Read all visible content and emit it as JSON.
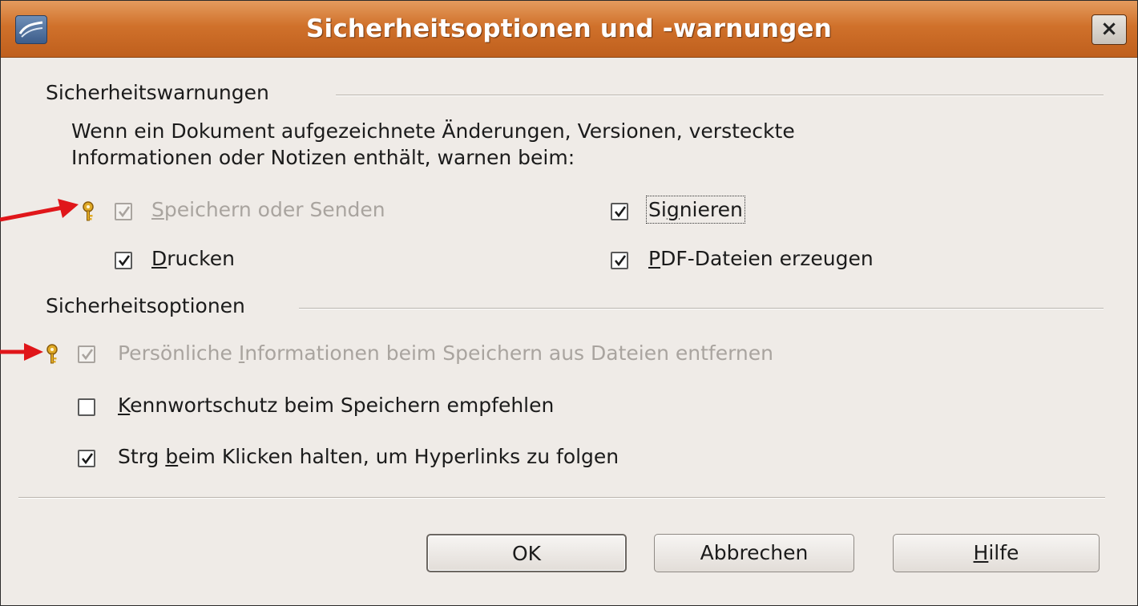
{
  "window": {
    "title": "Sicherheitsoptionen und -warnungen",
    "close_symbol": "×"
  },
  "warnings": {
    "header": "Sicherheitswarnungen",
    "description_line1": "Wenn ein Dokument aufgezeichnete Änderungen, Versionen, versteckte",
    "description_line2": "Informationen oder Notizen enthält, warnen beim:",
    "options": [
      {
        "pre": "",
        "mnemonic": "S",
        "post": "peichern oder Senden",
        "checked": true,
        "disabled": true,
        "locked": true
      },
      {
        "pre": "Si",
        "mnemonic": "g",
        "post": "nieren",
        "checked": true,
        "disabled": false,
        "locked": false,
        "focused": true
      },
      {
        "pre": "",
        "mnemonic": "D",
        "post": "rucken",
        "checked": true,
        "disabled": false,
        "locked": false
      },
      {
        "pre": "",
        "mnemonic": "P",
        "post": "DF-Dateien erzeugen",
        "checked": true,
        "disabled": false,
        "locked": false
      }
    ]
  },
  "security": {
    "header": "Sicherheitsoptionen",
    "options": [
      {
        "pre": "Persönliche ",
        "mnemonic": "I",
        "post": "nformationen beim Speichern aus Dateien entfernen",
        "checked": true,
        "disabled": true,
        "locked": true
      },
      {
        "pre": "",
        "mnemonic": "K",
        "post": "ennwortschutz beim Speichern empfehlen",
        "checked": false,
        "disabled": false,
        "locked": false
      },
      {
        "pre": "Strg ",
        "mnemonic": "b",
        "post": "eim Klicken halten, um Hyperlinks zu folgen",
        "checked": true,
        "disabled": false,
        "locked": false
      }
    ]
  },
  "buttons": {
    "ok": "OK",
    "cancel": "Abbrechen",
    "help_mnemonic": "H",
    "help_rest": "ilfe"
  },
  "icons": [
    "app-icon",
    "close-icon",
    "key-icon",
    "checkbox-check-icon",
    "red-arrow-icon"
  ],
  "colors": {
    "titlebar": "#d0712b",
    "dialog_bg": "#efebe7",
    "disabled_text": "#a9a49f",
    "arrow": "#e0161a",
    "key": "#d8a21c"
  }
}
